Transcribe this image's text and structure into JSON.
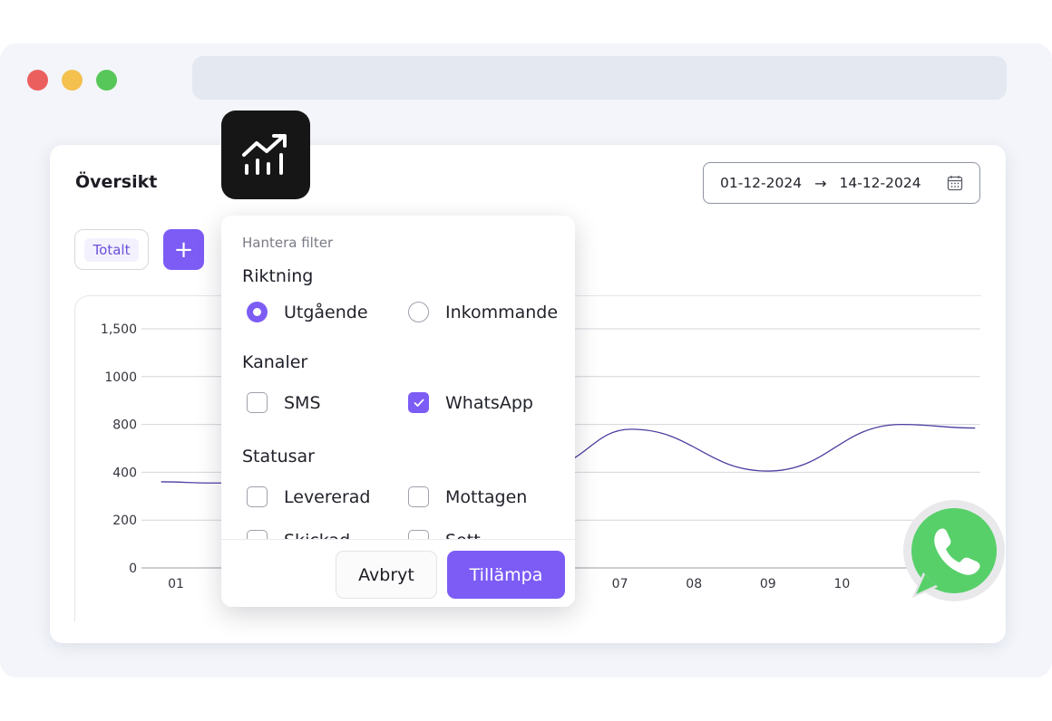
{
  "window": {
    "controls": [
      "close",
      "minimize",
      "maximize"
    ]
  },
  "dashboard": {
    "title": "Översikt",
    "date_from": "01-12-2024",
    "date_arrow": "→",
    "date_to": "14-12-2024",
    "calendar_icon": "calendar-icon",
    "tag_label": "Totalt",
    "add_label": "+"
  },
  "filter": {
    "heading": "Hantera filter",
    "direction": {
      "title": "Riktning",
      "options": [
        {
          "label": "Utgående",
          "selected": true
        },
        {
          "label": "Inkommande",
          "selected": false
        }
      ]
    },
    "channels": {
      "title": "Kanaler",
      "options": [
        {
          "label": "SMS",
          "checked": false
        },
        {
          "label": "WhatsApp",
          "checked": true
        }
      ]
    },
    "statuses": {
      "title": "Statusar",
      "options": [
        {
          "label": "Levererad",
          "checked": false
        },
        {
          "label": "Mottagen",
          "checked": false
        },
        {
          "label": "Skickad",
          "checked": false
        },
        {
          "label": "Sett",
          "checked": false
        }
      ]
    },
    "cancel_label": "Avbryt",
    "apply_label": "Tillämpa"
  },
  "colors": {
    "accent": "#7c5cf5",
    "line": "#4a3fa0",
    "whatsapp": "#58d06a"
  },
  "chart_data": {
    "type": "line",
    "y_ticks": [
      "1,500",
      "1000",
      "800",
      "400",
      "200",
      "0"
    ],
    "x_ticks": [
      "01",
      "07",
      "08",
      "09",
      "10"
    ],
    "x_tick_days": [
      1,
      7,
      8,
      9,
      10
    ],
    "ylim": [
      0,
      1500
    ],
    "grid": true,
    "series": [
      {
        "points": [
          {
            "x": 0.8,
            "y": 360
          },
          {
            "x": 1.5,
            "y": 355
          },
          {
            "x": 6.0,
            "y": 450
          },
          {
            "x": 7.15,
            "y": 760
          },
          {
            "x": 9.0,
            "y": 410
          },
          {
            "x": 10.8,
            "y": 800
          },
          {
            "x": 11.8,
            "y": 770
          }
        ]
      }
    ]
  }
}
